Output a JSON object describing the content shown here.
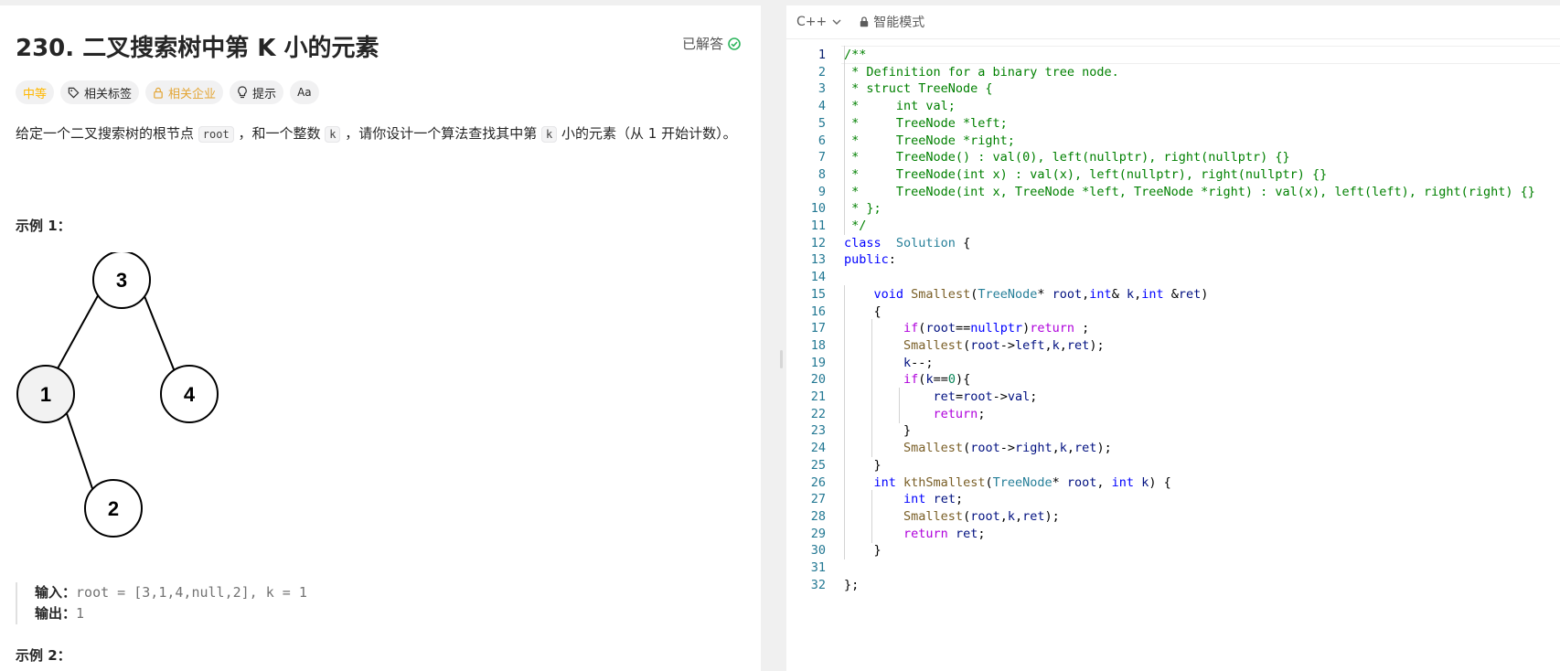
{
  "problem": {
    "title": "230. 二叉搜索树中第 K 小的元素",
    "solved_label": "已解答",
    "tags": [
      {
        "label": "中等",
        "icon": ""
      },
      {
        "label": "相关标签",
        "icon": "tag-icon"
      },
      {
        "label": "相关企业",
        "icon": "lock-icon"
      },
      {
        "label": "提示",
        "icon": "lightbulb-icon"
      },
      {
        "label": "Aa",
        "icon": "font-icon"
      }
    ],
    "description": {
      "part1": "给定一个二叉搜索树的根节点 ",
      "code1": "root",
      "part2": " ，和一个整数 ",
      "code2": "k",
      "part3": " ，请你设计一个算法查找其中第 ",
      "code3": "k",
      "part4": " 小的元素（从 1 开始计数）。"
    },
    "example1_title": "示例 1：",
    "tree_nodes": [
      "3",
      "1",
      "4",
      "2"
    ],
    "example1": {
      "input_label": "输入：",
      "input_value": "root = [3,1,4,null,2], k = 1",
      "output_label": "输出：",
      "output_value": "1"
    },
    "example2_title": "示例 2："
  },
  "editor": {
    "language": "C++",
    "mode_label": "智能模式",
    "current_line": 1,
    "lines": [
      [
        [
          "cm",
          "/**"
        ]
      ],
      [
        [
          "cm",
          " * Definition for a binary tree node."
        ]
      ],
      [
        [
          "cm",
          " * struct TreeNode {"
        ]
      ],
      [
        [
          "cm",
          " *     int val;"
        ]
      ],
      [
        [
          "cm",
          " *     TreeNode *left;"
        ]
      ],
      [
        [
          "cm",
          " *     TreeNode *right;"
        ]
      ],
      [
        [
          "cm",
          " *     TreeNode() : val(0), left(nullptr), right(nullptr) {}"
        ]
      ],
      [
        [
          "cm",
          " *     TreeNode(int x) : val(x), left(nullptr), right(nullptr) {}"
        ]
      ],
      [
        [
          "cm",
          " *     TreeNode(int x, TreeNode *left, TreeNode *right) : val(x), left(left), right(right) {}"
        ]
      ],
      [
        [
          "cm",
          " * };"
        ]
      ],
      [
        [
          "cm",
          " */"
        ]
      ],
      [
        [
          "kw",
          "class"
        ],
        [
          "",
          "  "
        ],
        [
          "ty",
          "Solution"
        ],
        [
          "",
          " {"
        ]
      ],
      [
        [
          "kw",
          "public"
        ],
        [
          "",
          ":"
        ]
      ],
      [
        [
          "",
          ""
        ]
      ],
      [
        [
          "",
          "    "
        ],
        [
          "kw",
          "void"
        ],
        [
          "",
          " "
        ],
        [
          "fn",
          "Smallest"
        ],
        [
          "",
          "("
        ],
        [
          "ty",
          "TreeNode"
        ],
        [
          "",
          "* "
        ],
        [
          "var",
          "root"
        ],
        [
          "",
          ","
        ],
        [
          "kw",
          "int"
        ],
        [
          "",
          "& "
        ],
        [
          "var",
          "k"
        ],
        [
          "",
          ","
        ],
        [
          "kw",
          "int"
        ],
        [
          "",
          " &"
        ],
        [
          "var",
          "ret"
        ],
        [
          "",
          ")"
        ]
      ],
      [
        [
          "",
          "    {"
        ]
      ],
      [
        [
          "",
          "        "
        ],
        [
          "ctl",
          "if"
        ],
        [
          "",
          "("
        ],
        [
          "var",
          "root"
        ],
        [
          "",
          "=="
        ],
        [
          "kw",
          "nullptr"
        ],
        [
          "",
          ")"
        ],
        [
          "ctl",
          "return"
        ],
        [
          "",
          " ;"
        ]
      ],
      [
        [
          "",
          "        "
        ],
        [
          "fn",
          "Smallest"
        ],
        [
          "",
          "("
        ],
        [
          "var",
          "root"
        ],
        [
          "",
          "->"
        ],
        [
          "var",
          "left"
        ],
        [
          "",
          ","
        ],
        [
          "var",
          "k"
        ],
        [
          "",
          ","
        ],
        [
          "var",
          "ret"
        ],
        [
          "",
          ");"
        ]
      ],
      [
        [
          "",
          "        "
        ],
        [
          "var",
          "k"
        ],
        [
          "",
          "--;"
        ]
      ],
      [
        [
          "",
          "        "
        ],
        [
          "ctl",
          "if"
        ],
        [
          "",
          "("
        ],
        [
          "var",
          "k"
        ],
        [
          "",
          "=="
        ],
        [
          "num",
          "0"
        ],
        [
          "",
          "){"
        ]
      ],
      [
        [
          "",
          "            "
        ],
        [
          "var",
          "ret"
        ],
        [
          "",
          "="
        ],
        [
          "var",
          "root"
        ],
        [
          "",
          "->"
        ],
        [
          "var",
          "val"
        ],
        [
          "",
          ";"
        ]
      ],
      [
        [
          "",
          "            "
        ],
        [
          "ctl",
          "return"
        ],
        [
          "",
          ";"
        ]
      ],
      [
        [
          "",
          "        }"
        ]
      ],
      [
        [
          "",
          "        "
        ],
        [
          "fn",
          "Smallest"
        ],
        [
          "",
          "("
        ],
        [
          "var",
          "root"
        ],
        [
          "",
          "->"
        ],
        [
          "var",
          "right"
        ],
        [
          "",
          ","
        ],
        [
          "var",
          "k"
        ],
        [
          "",
          ","
        ],
        [
          "var",
          "ret"
        ],
        [
          "",
          ");"
        ]
      ],
      [
        [
          "",
          "    }"
        ]
      ],
      [
        [
          "",
          "    "
        ],
        [
          "kw",
          "int"
        ],
        [
          "",
          " "
        ],
        [
          "fn",
          "kthSmallest"
        ],
        [
          "",
          "("
        ],
        [
          "ty",
          "TreeNode"
        ],
        [
          "",
          "* "
        ],
        [
          "var",
          "root"
        ],
        [
          "",
          ", "
        ],
        [
          "kw",
          "int"
        ],
        [
          "",
          " "
        ],
        [
          "var",
          "k"
        ],
        [
          "",
          ") {"
        ]
      ],
      [
        [
          "",
          "        "
        ],
        [
          "kw",
          "int"
        ],
        [
          "",
          " "
        ],
        [
          "var",
          "ret"
        ],
        [
          "",
          ";"
        ]
      ],
      [
        [
          "",
          "        "
        ],
        [
          "fn",
          "Smallest"
        ],
        [
          "",
          "("
        ],
        [
          "var",
          "root"
        ],
        [
          "",
          ","
        ],
        [
          "var",
          "k"
        ],
        [
          "",
          ","
        ],
        [
          "var",
          "ret"
        ],
        [
          "",
          ");"
        ]
      ],
      [
        [
          "",
          "        "
        ],
        [
          "ctl",
          "return"
        ],
        [
          "",
          " "
        ],
        [
          "var",
          "ret"
        ],
        [
          "",
          ";"
        ]
      ],
      [
        [
          "",
          "    }"
        ]
      ],
      [
        [
          "",
          ""
        ]
      ],
      [
        [
          "",
          "};"
        ]
      ]
    ]
  }
}
